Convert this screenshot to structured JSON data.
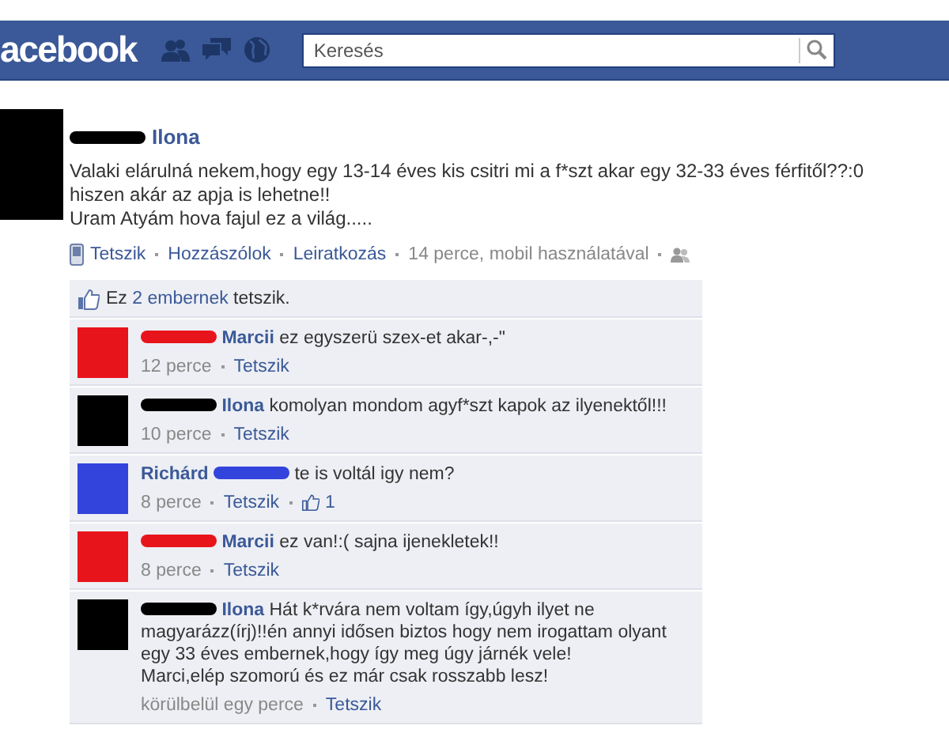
{
  "header": {
    "logo": "acebook",
    "search": {
      "placeholder": "Keresés"
    }
  },
  "post": {
    "redaction": {
      "color": "#000000"
    },
    "author": "Ilona",
    "lines": [
      "Valaki elárulná nekem,hogy egy 13-14 éves kis csitri mi a f*szt akar egy 32-33 éves férfitől??:0",
      "hiszen akár az apja is lehetne!!",
      "Uram Atyám hova fajul ez a világ....."
    ],
    "actions": [
      "Tetszik",
      "Hozzászólok",
      "Leiratkozás"
    ],
    "time": "14 perce, mobil használatával"
  },
  "likes": {
    "prefix": "Ez",
    "link": "2 embernek",
    "suffix": "tetszik."
  },
  "comments": [
    {
      "redaction": {
        "color": "#e8141c",
        "after": false
      },
      "name": "Marcii",
      "lines": [
        "ez egyszerü szex-et akar-,-\""
      ],
      "time": "12 perce",
      "like": "Tetszik"
    },
    {
      "redaction": {
        "color": "#000000",
        "after": false
      },
      "name": "Ilona",
      "lines": [
        "komolyan mondom agyf*szt kapok az ilyenektől!!!"
      ],
      "time": "10 perce",
      "like": "Tetszik"
    },
    {
      "redaction": {
        "color": "#3344dd",
        "after": true
      },
      "name": "Richárd",
      "lines": [
        "te is voltál igy nem?"
      ],
      "time": "8 perce",
      "like": "Tetszik",
      "like_count": "1"
    },
    {
      "redaction": {
        "color": "#e8141c",
        "after": false
      },
      "name": "Marcii",
      "lines": [
        "ez van!:( sajna ijenekletek!!"
      ],
      "time": "8 perce",
      "like": "Tetszik"
    },
    {
      "redaction": {
        "color": "#000000",
        "after": false
      },
      "name": "Ilona",
      "lines": [
        "Hát k*rvára nem voltam így,úgyh ilyet ne",
        "magyarázz(írj)!!én annyi idősen biztos hogy nem irogattam olyant",
        "egy 33 éves embernek,hogy így meg úgy járnék vele!",
        "Marci,elép szomorú és ez már csak rosszabb lesz!"
      ],
      "time": "körülbelül egy perce",
      "like": "Tetszik"
    }
  ]
}
